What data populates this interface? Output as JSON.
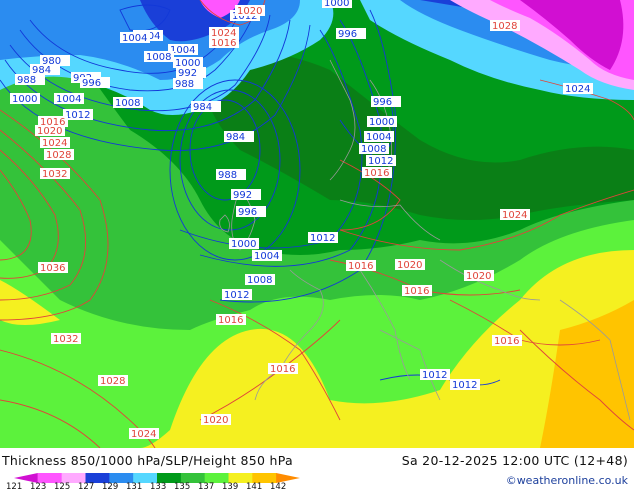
{
  "title": "Thickness 850/1000 hPa/SLP/Height 850 hPa",
  "valid_time": "Sa 20-12-2025 12:00 UTC (12+48)",
  "credit": "©weatheronline.co.uk",
  "legend": {
    "ticks": [
      "121",
      "123",
      "125",
      "127",
      "129",
      "131",
      "133",
      "135",
      "137",
      "139",
      "141",
      "142"
    ],
    "colors": [
      "#d10fd2",
      "#ff55ff",
      "#ffaaff",
      "#1a3fd8",
      "#2b8cf0",
      "#55d7ff",
      "#009a1a",
      "#34c23a",
      "#5cf23c",
      "#f5f020",
      "#ffc400",
      "#ff8c00"
    ]
  },
  "colors": {
    "isobar_high": "#e0443a",
    "isobar_low": "#1238d8",
    "label_box": "#ffffff",
    "coastline": "#9a9a9a"
  },
  "isobar_labels_blue": [
    "1000",
    "1004",
    "1004",
    "1008",
    "1004",
    "1000",
    "992",
    "988",
    "996",
    "980",
    "984",
    "988",
    "992",
    "996",
    "1000",
    "1004",
    "1012",
    "1008",
    "984",
    "984",
    "988",
    "992",
    "996",
    "1000",
    "1004",
    "1008",
    "1012",
    "1012",
    "996",
    "1000",
    "1004",
    "1008",
    "1012",
    "1012",
    "1012",
    "1012",
    "1024"
  ],
  "isobar_labels_red": [
    "1020",
    "1024",
    "1016",
    "1016",
    "1020",
    "1024",
    "1028",
    "1032",
    "1036",
    "1032",
    "1028",
    "1024",
    "1020",
    "1016",
    "1016",
    "1016",
    "1020",
    "1016",
    "1020",
    "1024",
    "1016",
    "1016",
    "1028"
  ]
}
